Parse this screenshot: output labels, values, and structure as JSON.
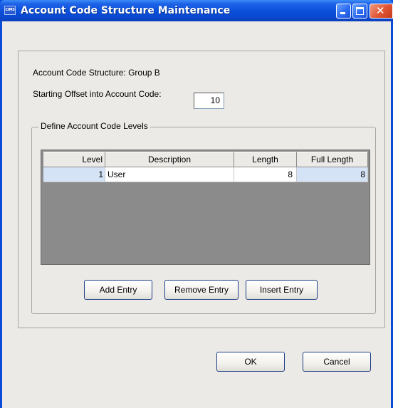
{
  "window": {
    "app_icon_text": "CIMS",
    "title": "Account Code Structure Maintenance",
    "icons": [
      "minimize-icon",
      "maximize-icon",
      "close-icon"
    ],
    "close_glyph": "✕",
    "colors": {
      "titlebar": "#0a4fd9",
      "client": "#ebeae6",
      "grid_background": "#8b8b8b",
      "selected_cell": "#d5e3f7"
    }
  },
  "form": {
    "structure_label": "Account Code Structure: Group B",
    "offset_label": "Starting Offset into Account Code:",
    "offset_value": "10"
  },
  "levels": {
    "group_title": "Define Account Code Levels",
    "columns": [
      "Level",
      "Description",
      "Length",
      "Full Length"
    ],
    "rows": [
      {
        "level": "1",
        "description": "User",
        "length": "8",
        "full_length": "8"
      }
    ],
    "buttons": {
      "add": "Add Entry",
      "remove": "Remove Entry",
      "insert": "Insert Entry"
    }
  },
  "dialog_buttons": {
    "ok": "OK",
    "cancel": "Cancel"
  }
}
